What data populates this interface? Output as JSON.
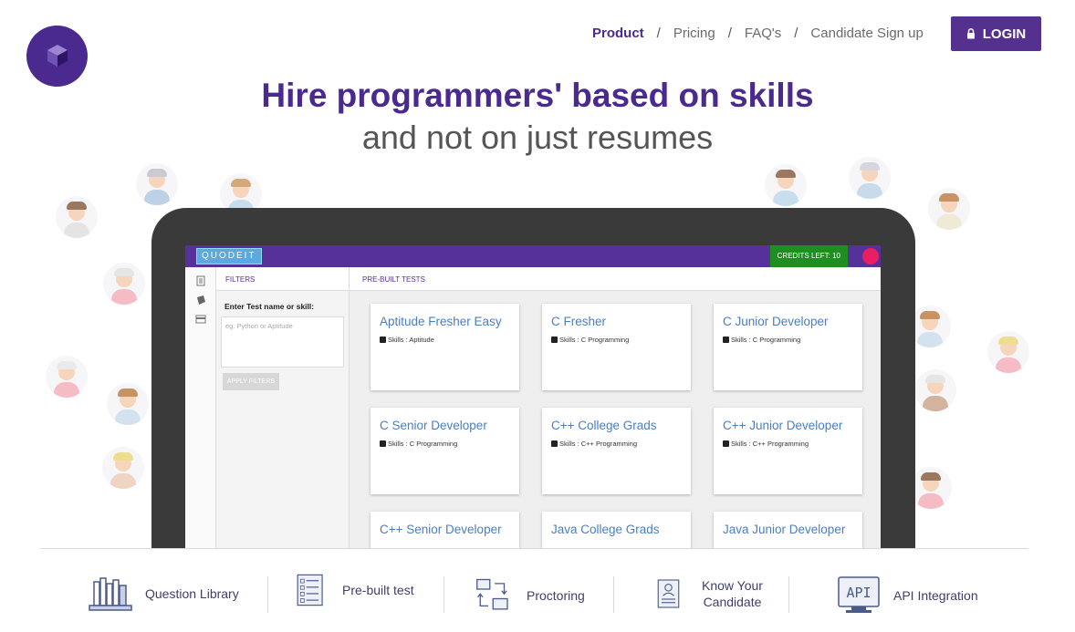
{
  "nav": {
    "items": [
      "Product",
      "Pricing",
      "FAQ's",
      "Candidate Sign up"
    ],
    "separator": "/",
    "active": "Product",
    "login_label": "LOGIN"
  },
  "hero": {
    "headline": "Hire programmers' based on skills",
    "subhead": "and not on just resumes"
  },
  "app": {
    "logo_text": "QUODEIT",
    "credits": "CREDITS LEFT: 10",
    "filters": {
      "title": "FILTERS",
      "label": "Enter Test name or skill:",
      "placeholder": "eg. Python or Aptitude",
      "apply": "APPLY FILTERS"
    },
    "tests_title": "PRE-BUILT TESTS",
    "cards": [
      {
        "title": "Aptitude Fresher Easy",
        "skill": "Skills : Aptitude"
      },
      {
        "title": "C Fresher",
        "skill": "Skills : C Programming"
      },
      {
        "title": "C Junior Developer",
        "skill": "Skills : C Programming"
      },
      {
        "title": "C Senior Developer",
        "skill": "Skills : C Programming"
      },
      {
        "title": "C++ College Grads",
        "skill": "Skills : C++ Programming"
      },
      {
        "title": "C++ Junior Developer",
        "skill": "Skills : C++ Programming"
      },
      {
        "title": "C++ Senior Developer",
        "skill": ""
      },
      {
        "title": "Java College Grads",
        "skill": ""
      },
      {
        "title": "Java Junior Developer",
        "skill": ""
      }
    ]
  },
  "features": [
    {
      "label": "Question Library",
      "icon": "library-icon"
    },
    {
      "label": "Pre-built test",
      "icon": "checklist-icon"
    },
    {
      "label": "Proctoring",
      "icon": "proctoring-icon"
    },
    {
      "label": "Know Your\nCandidate",
      "icon": "candidate-id-icon"
    },
    {
      "label": "API Integration",
      "icon": "api-icon"
    }
  ],
  "colors": {
    "brand": "#4b2a8f",
    "login_bg": "#54308f",
    "card_title": "#4a7fbf",
    "credits_bg": "#1e8f1e",
    "user_dot": "#e91e63"
  }
}
